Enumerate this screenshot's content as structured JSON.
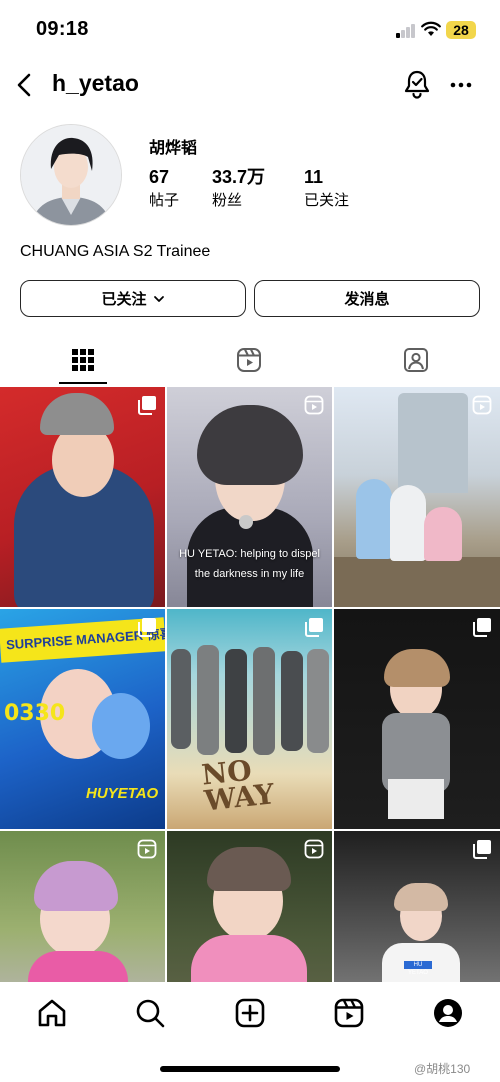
{
  "status_bar": {
    "time": "09:18",
    "battery": "28"
  },
  "header": {
    "username": "h_yetao"
  },
  "profile": {
    "display_name": "胡烨韬",
    "stats": [
      {
        "value": "67",
        "label": "帖子"
      },
      {
        "value": "33.7万",
        "label": "粉丝"
      },
      {
        "value": "11",
        "label": "已关注"
      }
    ],
    "bio": "CHUANG ASIA S2 Trainee"
  },
  "actions": {
    "following_label": "已关注",
    "message_label": "发消息"
  },
  "tabs": [
    "posts-grid",
    "reels",
    "tagged"
  ],
  "grid": {
    "posts": [
      {
        "kind": "carousel"
      },
      {
        "kind": "reel",
        "caption_lines": [
          "HU YETAO: helping to dispel",
          "the darkness in my life"
        ]
      },
      {
        "kind": "reel"
      },
      {
        "kind": "carousel",
        "art_text": [
          "SURPRISE MANAGER 惊喜店长",
          "0330",
          "HUYETAO"
        ]
      },
      {
        "kind": "carousel",
        "art_text": [
          "NO",
          "WAY"
        ]
      },
      {
        "kind": "carousel"
      },
      {
        "kind": "reel"
      },
      {
        "kind": "reel"
      },
      {
        "kind": "carousel",
        "art_text": [
          "HU YETAO"
        ]
      }
    ]
  },
  "bottom_nav": [
    "home-icon",
    "search-icon",
    "create-icon",
    "reels-icon",
    "profile-icon"
  ],
  "watermark": "@胡桃130",
  "colors": {
    "button_border": "#262626",
    "battery": "#f2d64b",
    "tab_active": "#000000"
  }
}
